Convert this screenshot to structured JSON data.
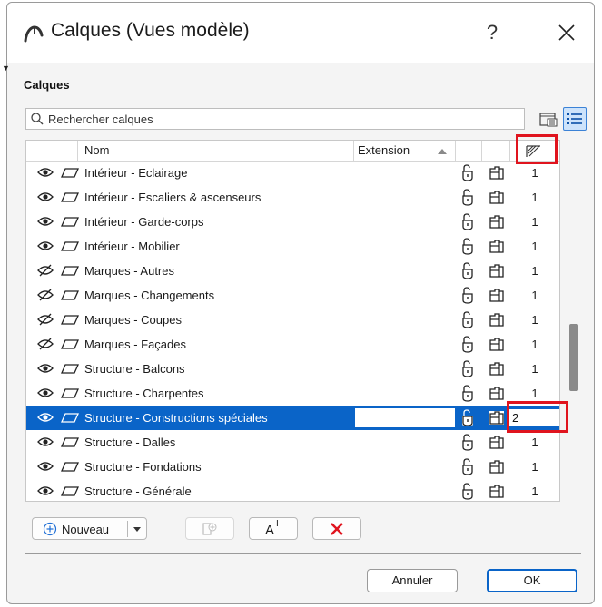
{
  "window": {
    "title": "Calques (Vues modèle)",
    "help_label": "?"
  },
  "section": {
    "label": "Calques"
  },
  "search": {
    "placeholder": "Rechercher calques",
    "value": ""
  },
  "table": {
    "headers": {
      "name": "Nom",
      "extension": "Extension"
    },
    "rows": [
      {
        "name": "Intérieur - Eclairage",
        "visible": true,
        "intersection": "1"
      },
      {
        "name": "Intérieur - Escaliers & ascenseurs",
        "visible": true,
        "intersection": "1"
      },
      {
        "name": "Intérieur - Garde-corps",
        "visible": true,
        "intersection": "1"
      },
      {
        "name": "Intérieur - Mobilier",
        "visible": true,
        "intersection": "1"
      },
      {
        "name": "Marques - Autres",
        "visible": false,
        "intersection": "1"
      },
      {
        "name": "Marques - Changements",
        "visible": false,
        "intersection": "1"
      },
      {
        "name": "Marques - Coupes",
        "visible": false,
        "intersection": "1"
      },
      {
        "name": "Marques - Façades",
        "visible": false,
        "intersection": "1"
      },
      {
        "name": "Structure - Balcons",
        "visible": true,
        "intersection": "1"
      },
      {
        "name": "Structure - Charpentes",
        "visible": true,
        "intersection": "1"
      },
      {
        "name": "Structure - Constructions spéciales",
        "visible": true,
        "intersection": "2",
        "selected": true
      },
      {
        "name": "Structure - Dalles",
        "visible": true,
        "intersection": "1"
      },
      {
        "name": "Structure - Fondations",
        "visible": true,
        "intersection": "1"
      },
      {
        "name": "Structure - Générale",
        "visible": true,
        "intersection": "1"
      }
    ]
  },
  "actions": {
    "new_label": "Nouveau",
    "rename_glyph": "A",
    "rename_cursor": "I"
  },
  "footer": {
    "cancel_label": "Annuler",
    "ok_label": "OK"
  },
  "colors": {
    "selection": "#0a64c8",
    "highlight": "#e0141e",
    "delete": "#e0141e"
  }
}
